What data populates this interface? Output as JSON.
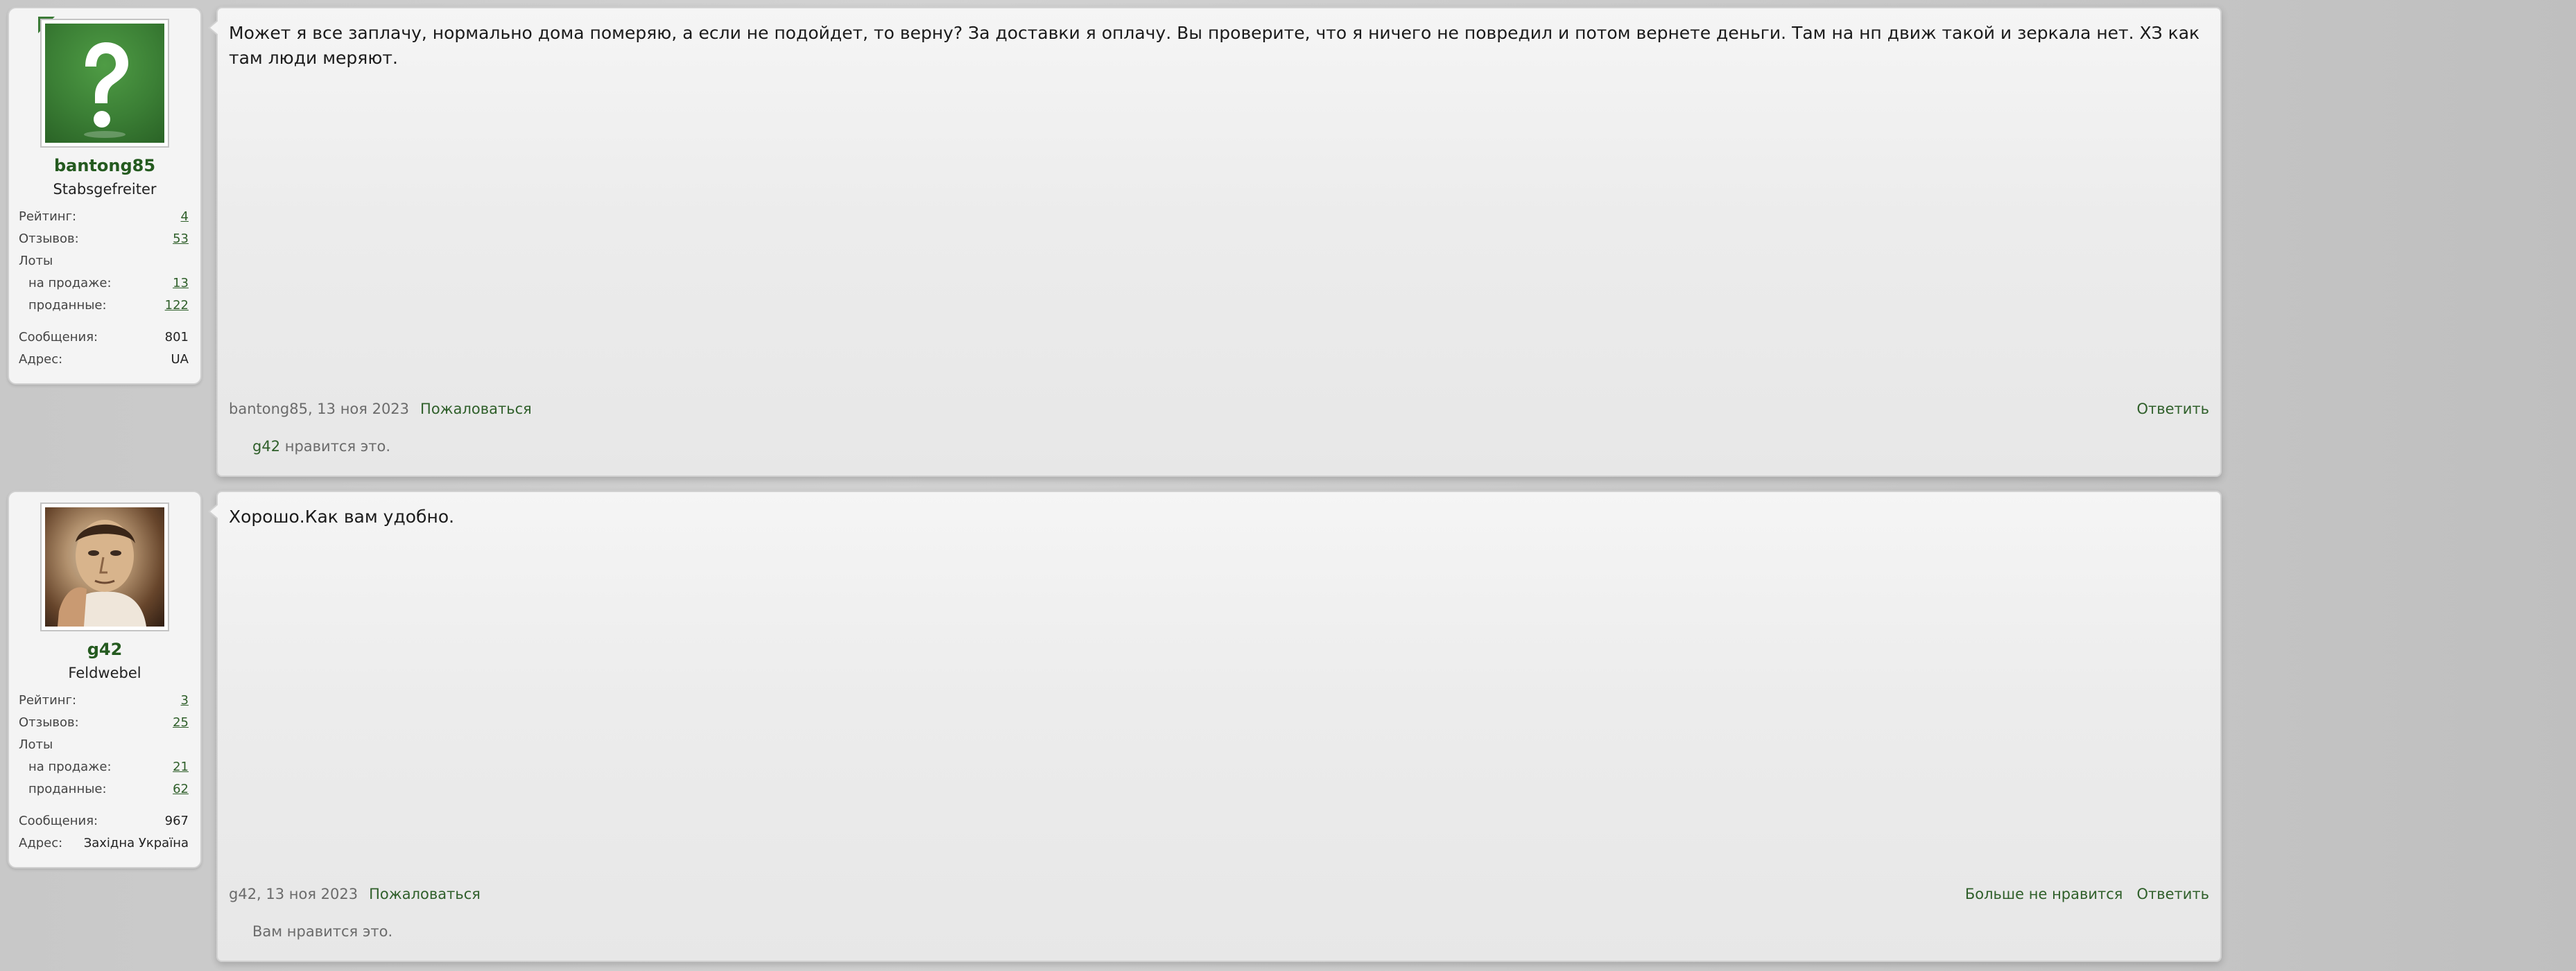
{
  "posts": [
    {
      "user": {
        "avatar": "question-mark-avatar",
        "username": "bantong85",
        "title": "Stabsgefreiter",
        "stats": [
          {
            "label": "Рейтинг:",
            "value": "4"
          },
          {
            "label": "Отзывов:",
            "value": "53"
          },
          {
            "label": "Лоты",
            "value": ""
          },
          {
            "label": "на продаже:",
            "value": "13"
          },
          {
            "label": "проданные:",
            "value": "122"
          },
          {
            "label": "Сообщения:",
            "value": "801"
          },
          {
            "label": "Адрес:",
            "value": "UA"
          }
        ]
      },
      "message": "Может я все заплачу, нормально дома померяю, а если не подойдет, то верну? За доставки я оплачу. Вы проверите, что я ничего не повредил и потом вернете деньги. Там на нп движ такой и зеркала нет. ХЗ как там люди меряют.",
      "meta": {
        "author_date": "bantong85, 13 ноя 2023",
        "report_label": "Пожаловаться"
      },
      "actions": {
        "reply_label": "Ответить"
      },
      "likes": {
        "liker": "g42",
        "suffix": " нравится это."
      }
    },
    {
      "user": {
        "avatar": "portrait-photo-avatar",
        "username": "g42",
        "title": "Feldwebel",
        "stats": [
          {
            "label": "Рейтинг:",
            "value": "3"
          },
          {
            "label": "Отзывов:",
            "value": "25"
          },
          {
            "label": "Лоты",
            "value": ""
          },
          {
            "label": "на продаже:",
            "value": "21"
          },
          {
            "label": "проданные:",
            "value": "62"
          },
          {
            "label": "Сообщения:",
            "value": "967"
          },
          {
            "label": "Адрес:",
            "value": "Західна Україна"
          }
        ]
      },
      "message": "Хорошо.Как вам удобно.",
      "meta": {
        "author_date": "g42, 13 ноя 2023",
        "report_label": "Пожаловаться"
      },
      "actions": {
        "unlike_label": "Больше не нравится",
        "reply_label": "Ответить"
      },
      "likes": {
        "text": "Вам нравится это."
      }
    }
  ]
}
